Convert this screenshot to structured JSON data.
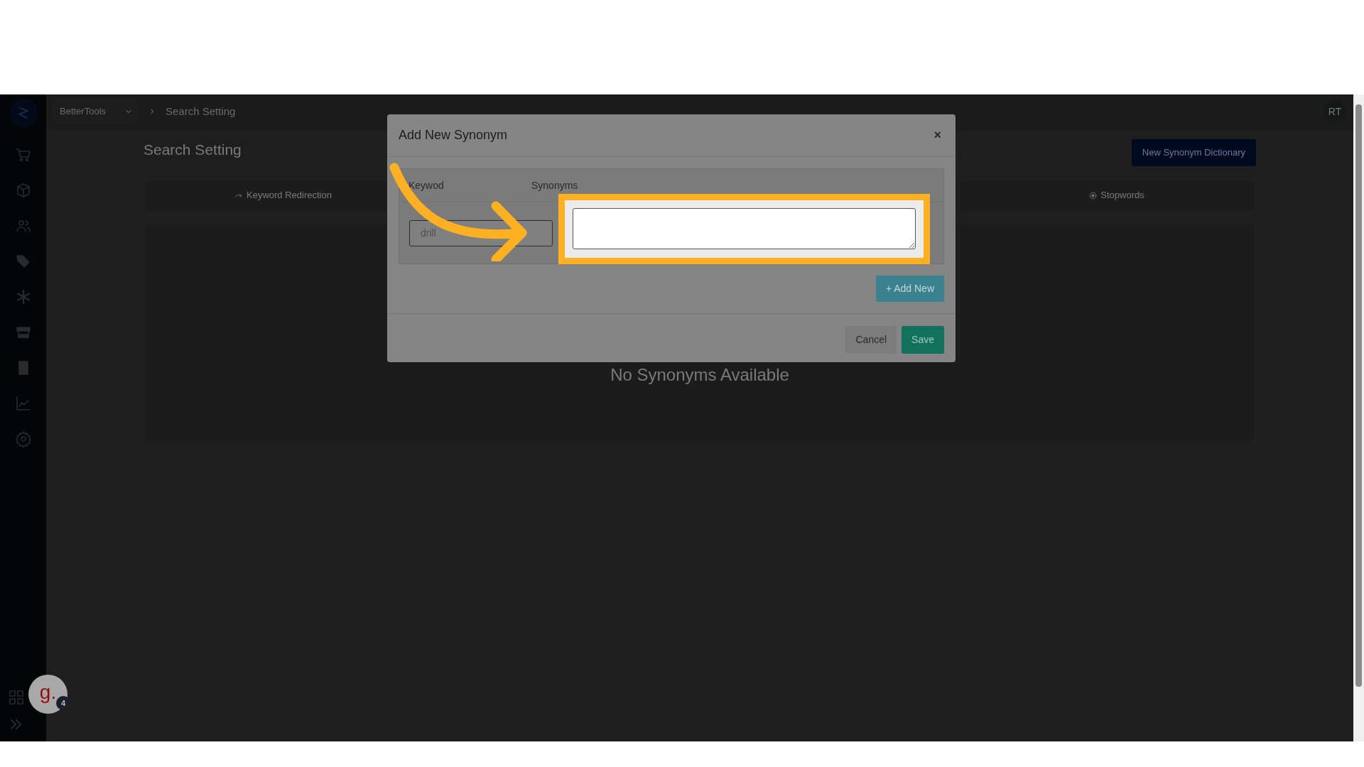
{
  "topbar": {
    "store_selector": "BetterTools",
    "breadcrumb": "Search Setting",
    "avatar": "RT"
  },
  "page": {
    "title": "Search Setting",
    "primary_button": "New Synonym Dictionary",
    "tabs": [
      {
        "label": "Keyword Redirection",
        "kind": "redirect"
      },
      {
        "label": "Stopwords",
        "kind": "stop"
      }
    ],
    "empty_message": "No Synonyms Available"
  },
  "modal": {
    "title": "Add New Synonym",
    "close": "×",
    "columns": [
      "Keywod",
      "Synonyms"
    ],
    "rows": [
      {
        "keyword": "drill"
      }
    ],
    "add_button": "+ Add New",
    "buttons": [
      {
        "label": "Cancel",
        "kind": "secondary"
      },
      {
        "label": "Save",
        "kind": "primary"
      }
    ]
  },
  "help_widget": {
    "logo": "g.",
    "badge": "4"
  }
}
